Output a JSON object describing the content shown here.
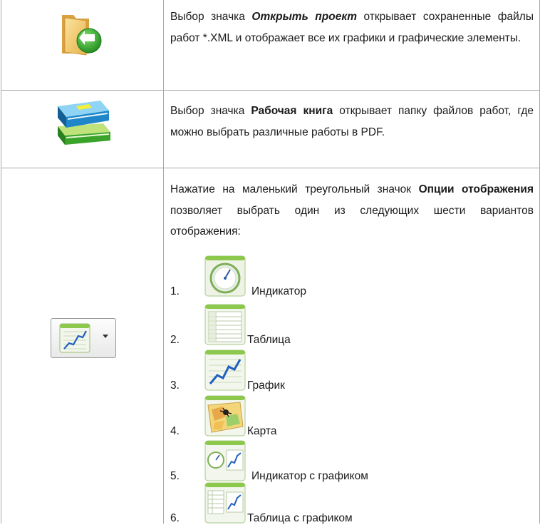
{
  "rows": [
    {
      "icon": "open-project-folder-icon",
      "text_parts": [
        {
          "t": "Выбор значка ",
          "style": "normal"
        },
        {
          "t": "Открыть проект",
          "style": "bold-italic"
        },
        {
          "t": " открывает сохраненные файлы работ *.XML и отображает все их графики и графические элементы.",
          "style": "normal"
        }
      ]
    },
    {
      "icon": "workbook-icon",
      "text_parts": [
        {
          "t": "Выбор значка ",
          "style": "normal"
        },
        {
          "t": "Рабочая книга",
          "style": "bold"
        },
        {
          "t": " открывает папку файлов работ, где можно выбрать различные работы в PDF.",
          "style": "normal"
        }
      ]
    },
    {
      "icon": "display-options-icon",
      "text_parts": [
        {
          "t": "Нажатие на маленький треугольный значок ",
          "style": "normal"
        },
        {
          "t": "Опции отображения",
          "style": "bold"
        },
        {
          "t": " позволяет выбрать один из следующих шести вариантов отображения:",
          "style": "normal"
        }
      ],
      "options": [
        {
          "num": "1.",
          "label": "Индикатор",
          "icon": "meter-icon"
        },
        {
          "num": "2.",
          "label": "Таблица",
          "icon": "table-icon"
        },
        {
          "num": "3.",
          "label": "График",
          "icon": "graph-icon"
        },
        {
          "num": "4.",
          "label": "Карта",
          "icon": "map-icon"
        },
        {
          "num": "5.",
          "label": "Индикатор с графиком",
          "icon": "meter-with-graph-icon"
        },
        {
          "num": "6.",
          "label": "Таблица с графиком",
          "icon": "table-with-graph-icon"
        }
      ]
    }
  ]
}
